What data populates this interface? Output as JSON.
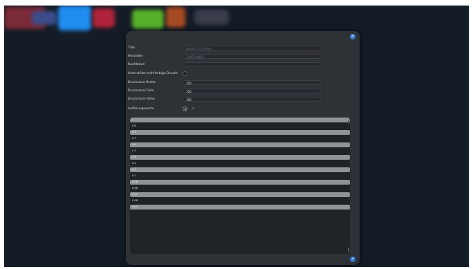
{
  "dialog": {
    "fields": [
      {
        "label": "Titel",
        "value": "Generic 3D Printer",
        "dim": true
      },
      {
        "label": "Hersteller",
        "value": "SUNSOUNDS",
        "dim": true
      },
      {
        "label": "Kaufdatum",
        "value": "",
        "dim": false
      }
    ],
    "multi_print_label": "Unterstützt mehrfarbige Drucke",
    "dims": [
      {
        "label": "Druckraum-Breite",
        "value": "150"
      },
      {
        "label": "Druckraum-Tiefe",
        "value": "150"
      },
      {
        "label": "Druckraum-Höhe",
        "value": "150"
      }
    ],
    "resolution_label": "Auflösungswerte",
    "resolution_list": [
      "1",
      "0.6",
      "0.5",
      "0.7",
      "0.8",
      "0.3",
      "0.6",
      "0.2",
      "0.4",
      "0.1",
      "0.06",
      "0.08",
      "0.07",
      "0.08",
      "0.03"
    ]
  },
  "icons": {
    "close": "close-icon",
    "corner": "settings-icon"
  }
}
